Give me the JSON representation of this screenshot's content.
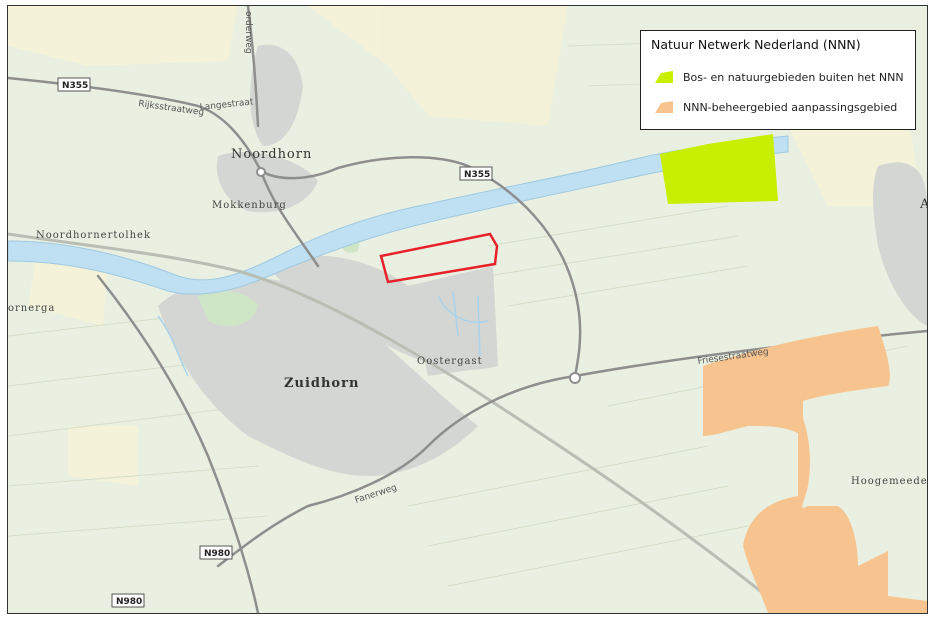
{
  "legend": {
    "title": "Natuur Netwerk Nederland (NNN)",
    "items": [
      {
        "label": "Bos- en natuurgebieden buiten het NNN",
        "color": "#c9ef00"
      },
      {
        "label": "NNN-beheergebied aanpassingsgebied",
        "color": "#f7c48f"
      }
    ]
  },
  "places": {
    "noordhorn": "Noordhorn",
    "mokkenburg": "Mokkenburg",
    "noordhornertolhek": "Noordhornertolhek",
    "zuidhorn": "Zuidhorn",
    "oostergast": "Oostergast",
    "hoogemeeden": "Hoogemeede",
    "ornerga": "ornerga",
    "edge_a": "A"
  },
  "roads": {
    "n355_west": "N355",
    "n355_east": "N355",
    "n980_mid": "N980",
    "n980_south": "N980",
    "rijksstraatweg": "Rijksstraatweg",
    "langestraat": "Langestraat",
    "faner": "Fanerweg",
    "friesestraatweg": "Friesestraatweg",
    "noorderweg": "orderweg"
  },
  "colors": {
    "land": "#e9f0e1",
    "water": "#bfe0f2",
    "urban": "#d3d6d2",
    "road": "#8e8e8e",
    "boundary": "#e8202a"
  }
}
